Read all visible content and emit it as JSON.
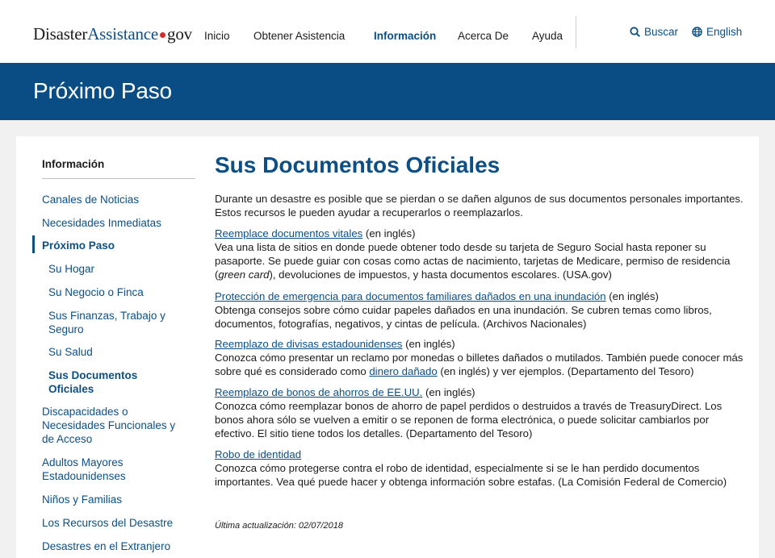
{
  "header": {
    "logo_part1": "Disaster",
    "logo_part2": "Assistance",
    "logo_part3": "gov",
    "nav": [
      {
        "label": "Inicio"
      },
      {
        "label": "Obtener Asistencia"
      },
      {
        "label": "Información"
      },
      {
        "label": "Acerca De"
      },
      {
        "label": "Ayuda"
      }
    ],
    "search_label": "Buscar",
    "language_label": "English"
  },
  "banner": {
    "title": "Próximo Paso"
  },
  "sidebar": {
    "heading": "Información",
    "items": [
      {
        "label": "Canales de Noticias"
      },
      {
        "label": "Necesidades Inmediatas"
      },
      {
        "label": "Próximo Paso"
      },
      {
        "label": "Su Hogar"
      },
      {
        "label": "Su Negocio o Finca"
      },
      {
        "label": "Sus Finanzas, Trabajo y Seguro"
      },
      {
        "label": "Su Salud"
      },
      {
        "label": "Sus Documentos Oficiales"
      },
      {
        "label": "Discapacidades o Necesidades Funcionales y de Acceso"
      },
      {
        "label": "Adultos Mayores Estadounidenses"
      },
      {
        "label": "Niños y Familias"
      },
      {
        "label": "Los Recursos del Desastre"
      },
      {
        "label": "Desastres en el Extranjero"
      }
    ]
  },
  "main": {
    "title": "Sus Documentos Oficiales",
    "intro": "Durante un desastre es posible que se pierdan o se dañen algunos de sus documentos personales importantes. Estos recursos le pueden ayudar a recuperarlos o reemplazarlos.",
    "sections": [
      {
        "link": "Reemplace documentos vitales",
        "suffix": " (en inglés)",
        "desc_a": "Vea una lista de sitios en donde puede obtener todo desde su tarjeta de Seguro Social hasta reponer su pasaporte. Se puede guiar con cosas como actas de nacimiento, tarjetas de Medicare, permiso de residencia (",
        "desc_em": "green card",
        "desc_b": "), devoluciones de impuestos, y hasta documentos escolares. (USA.gov)"
      },
      {
        "link": "Protección de emergencia para documentos familiares dañados en una inundación",
        "suffix": " (en inglés)",
        "desc": "Obtenga consejos sobre cómo cuidar papeles dañados en una inundación. Se cubren temas como libros, documentos, fotografías, negativos, y cintas de película. (Archivos Nacionales)"
      },
      {
        "link": "Reemplazo de divisas estadounidenses",
        "suffix": " (en inglés)",
        "desc_a": "Conozca cómo presentar un reclamo por monedas o billetes dañados o mutilados. También puede conocer más sobre qué es considerado como ",
        "inline_link": "dinero dañado",
        "desc_b": " (en inglés) y ver ejemplos. (Departamento del Tesoro)"
      },
      {
        "link": "Reemplazo de bonos de ahorros de EE.UU.",
        "suffix": " (en inglés)",
        "desc": "Conozca cómo reemplazar bonos de ahorro de papel perdidos o destruidos a través de TreasuryDirect. Los bonos ahora sólo se vuelven a emitir o se reponen de forma electrónica, o puede solicitar cambiarlos por efectivo. El sitio tiene todos los detalles. (Departamento del Tesoro)"
      },
      {
        "link": "Robo de identidad",
        "desc": "Conozca cómo protegerse contra el robo de identidad, especialmente si se le han perdido documentos importantes. Vea qué puede hacer y obtenga información sobre estafas. (La Comisión Federal de Comercio)"
      }
    ],
    "updated": "Última actualización: 02/07/2018"
  },
  "colors": {
    "brand_blue": "#0a4d84",
    "link_blue": "#0b4f86",
    "logo_dot_red": "#d62c2c"
  }
}
